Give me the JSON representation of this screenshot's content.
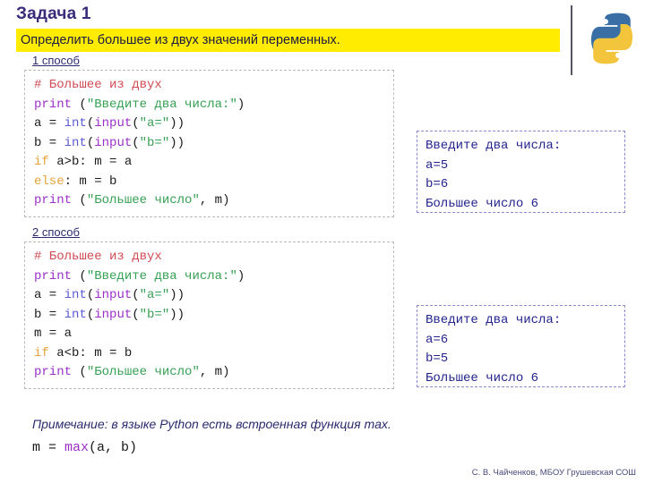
{
  "header": {
    "title": "Задача 1",
    "statement": "Определить большее из двух значений переменных."
  },
  "logo": {
    "name": "python-logo",
    "blue": "#3a6fa5",
    "yellow": "#f2c53d"
  },
  "methods": [
    {
      "label": "1 способ",
      "code": [
        [
          {
            "t": "# Большее из двух",
            "c": "comment"
          }
        ],
        [
          {
            "t": "print",
            "c": "func"
          },
          {
            "t": " (",
            "c": "plain"
          },
          {
            "t": "\"Введите два числа:\"",
            "c": "string"
          },
          {
            "t": ")",
            "c": "plain"
          }
        ],
        [
          {
            "t": "a = ",
            "c": "plain"
          },
          {
            "t": "int",
            "c": "builtin"
          },
          {
            "t": "(",
            "c": "plain"
          },
          {
            "t": "input",
            "c": "func"
          },
          {
            "t": "(",
            "c": "plain"
          },
          {
            "t": "\"a=\"",
            "c": "string"
          },
          {
            "t": "))",
            "c": "plain"
          }
        ],
        [
          {
            "t": "b = ",
            "c": "plain"
          },
          {
            "t": "int",
            "c": "builtin"
          },
          {
            "t": "(",
            "c": "plain"
          },
          {
            "t": "input",
            "c": "func"
          },
          {
            "t": "(",
            "c": "plain"
          },
          {
            "t": "\"b=\"",
            "c": "string"
          },
          {
            "t": "))",
            "c": "plain"
          }
        ],
        [
          {
            "t": "if",
            "c": "keyword"
          },
          {
            "t": " a>b: m = a",
            "c": "plain"
          }
        ],
        [
          {
            "t": "else",
            "c": "keyword"
          },
          {
            "t": ": m = b",
            "c": "plain"
          }
        ],
        [
          {
            "t": "print",
            "c": "func"
          },
          {
            "t": " (",
            "c": "plain"
          },
          {
            "t": "\"Большее число\"",
            "c": "string"
          },
          {
            "t": ", m)",
            "c": "plain"
          }
        ]
      ],
      "output": [
        "Введите два числа:",
        "a=5",
        "b=6",
        "Большее число 6"
      ]
    },
    {
      "label": "2 способ",
      "code": [
        [
          {
            "t": "# Большее из двух",
            "c": "comment"
          }
        ],
        [
          {
            "t": "print",
            "c": "func"
          },
          {
            "t": " (",
            "c": "plain"
          },
          {
            "t": "\"Введите два числа:\"",
            "c": "string"
          },
          {
            "t": ")",
            "c": "plain"
          }
        ],
        [
          {
            "t": "a = ",
            "c": "plain"
          },
          {
            "t": "int",
            "c": "builtin"
          },
          {
            "t": "(",
            "c": "plain"
          },
          {
            "t": "input",
            "c": "func"
          },
          {
            "t": "(",
            "c": "plain"
          },
          {
            "t": "\"a=\"",
            "c": "string"
          },
          {
            "t": "))",
            "c": "plain"
          }
        ],
        [
          {
            "t": "b = ",
            "c": "plain"
          },
          {
            "t": "int",
            "c": "builtin"
          },
          {
            "t": "(",
            "c": "plain"
          },
          {
            "t": "input",
            "c": "func"
          },
          {
            "t": "(",
            "c": "plain"
          },
          {
            "t": "\"b=\"",
            "c": "string"
          },
          {
            "t": "))",
            "c": "plain"
          }
        ],
        [
          {
            "t": "m = a",
            "c": "plain"
          }
        ],
        [
          {
            "t": "if",
            "c": "keyword"
          },
          {
            "t": " a<b: m = b",
            "c": "plain"
          }
        ],
        [
          {
            "t": "print",
            "c": "func"
          },
          {
            "t": " (",
            "c": "plain"
          },
          {
            "t": "\"Большее число\"",
            "c": "string"
          },
          {
            "t": ", m)",
            "c": "plain"
          }
        ]
      ],
      "output": [
        "Введите два числа:",
        "a=6",
        "b=5",
        "Большее число 6"
      ]
    }
  ],
  "note": {
    "text": "Примечание: в языке Python есть встроенная функция max.",
    "code": [
      {
        "t": "m = ",
        "c": "plain"
      },
      {
        "t": "max",
        "c": "func"
      },
      {
        "t": "(a, b)",
        "c": "plain"
      }
    ]
  },
  "footer": {
    "credit": "С. В. Чайченков, МБОУ Грушевская СОШ"
  }
}
